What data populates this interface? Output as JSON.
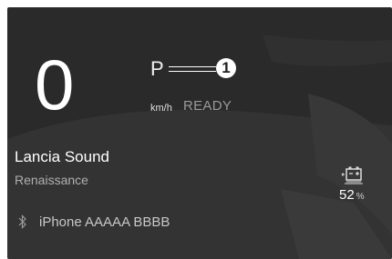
{
  "gauge": {
    "speed": "0",
    "gear": "P",
    "callout_number": "1",
    "speed_unit": "km/h",
    "status": "READY"
  },
  "audio": {
    "source_title": "Lancia Sound",
    "track": "Renaissance"
  },
  "bluetooth": {
    "icon": "bluetooth-icon",
    "device_name": "iPhone AAAAA BBBB"
  },
  "battery": {
    "icon": "battery-icon",
    "value": "52",
    "unit": "%"
  },
  "colors": {
    "background": "#2a2a2a",
    "text_primary": "#ffffff",
    "text_secondary": "#9a9a9a"
  }
}
